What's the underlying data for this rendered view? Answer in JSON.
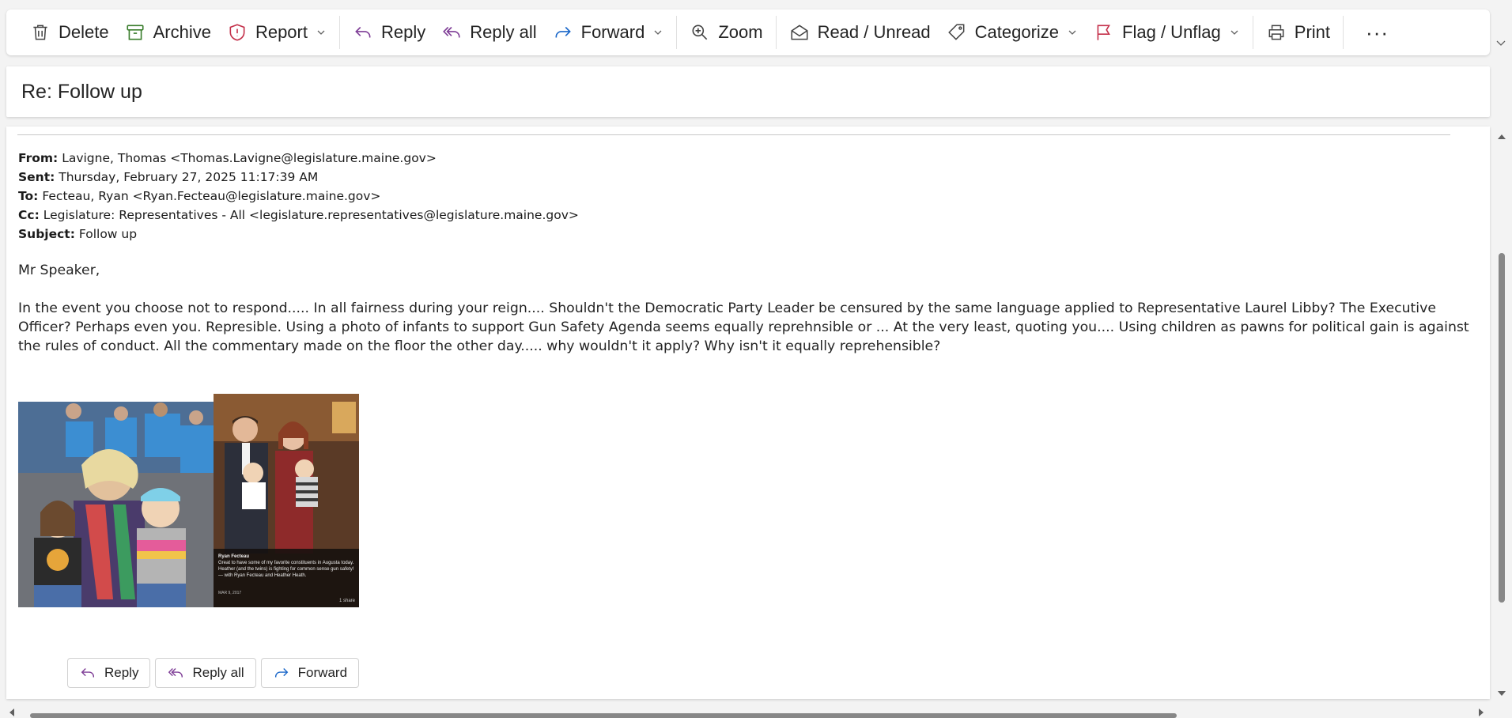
{
  "toolbar": {
    "delete_label": "Delete",
    "archive_label": "Archive",
    "report_label": "Report",
    "reply_label": "Reply",
    "reply_all_label": "Reply all",
    "forward_label": "Forward",
    "zoom_label": "Zoom",
    "read_unread_label": "Read / Unread",
    "categorize_label": "Categorize",
    "flag_label": "Flag / Unflag",
    "print_label": "Print",
    "more_label": "···"
  },
  "colors": {
    "archive_icon": "#3a7d2c",
    "report_icon": "#c4314b",
    "reply_icon": "#7e3d96",
    "forward_icon": "#1a67c9",
    "flag_icon": "#c4314b"
  },
  "email": {
    "subject_title": "Re: Follow up",
    "headers": {
      "from_label": "From:",
      "from_value": "Lavigne, Thomas <Thomas.Lavigne@legislature.maine.gov>",
      "sent_label": "Sent:",
      "sent_value": "Thursday, February 27, 2025 11:17:39 AM",
      "to_label": "To:",
      "to_value": "Fecteau, Ryan <Ryan.Fecteau@legislature.maine.gov>",
      "cc_label": "Cc:",
      "cc_value": "Legislature: Representatives - All <legislature.representatives@legislature.maine.gov>",
      "subject_label": "Subject:",
      "subject_value": "Follow up"
    },
    "greeting": "Mr Speaker,",
    "body": "In the event you choose not to respond..... In all fairness during your reign.... Shouldn't the Democratic Party Leader be censured by the same language applied to Representative Laurel Libby?  The Executive Officer?  Perhaps even you. Represible.   Using a photo of infants to support Gun Safety Agenda seems equally reprehnsible or ... At the very least, quoting you.... Using children as pawns for political gain is against the rules of conduct.   All the commentary made on the floor the other day.....  why wouldn't it apply?  Why isn't it equally reprehensible?",
    "image_caption": {
      "name": "Ryan Fecteau",
      "text": "Great to have some of my favorite constituents in Augusta today. Heather (and the twins) is fighting for common sense gun safety! — with Ryan Fecteau and Heather Heath.",
      "date": "MAR 9, 2017",
      "shares": "1 share"
    }
  },
  "bottom_actions": {
    "reply_label": "Reply",
    "reply_all_label": "Reply all",
    "forward_label": "Forward"
  }
}
